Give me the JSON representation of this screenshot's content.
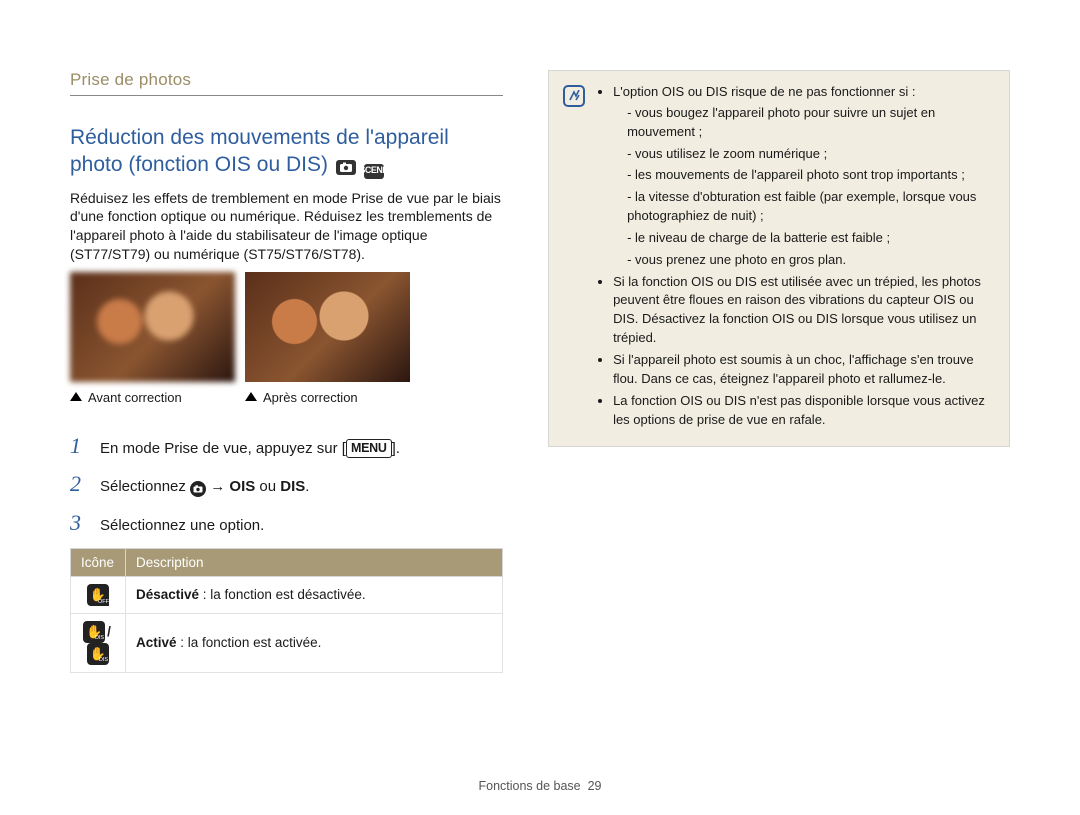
{
  "section_label": "Prise de photos",
  "title": "Réduction des mouvements de l'appareil photo (fonction OIS ou DIS)",
  "title_icon1_name": "camera-mode-icon",
  "title_icon2_name": "scene-mode-icon",
  "title_icon2_label": "SCENE",
  "intro": "Réduisez les effets de tremblement en mode Prise de vue par le biais d'une fonction optique ou numérique. Réduisez les tremblements de l'appareil photo à l'aide du stabilisateur de l'image optique (ST77/ST79) ou numérique (ST75/ST76/ST78).",
  "caption_before": "Avant correction",
  "caption_after": "Après correction",
  "steps": {
    "n1": "1",
    "t1_pre": "En mode Prise de vue, appuyez sur [",
    "t1_menu": "MENU",
    "t1_post": "].",
    "n2": "2",
    "t2_pre": "Sélectionnez ",
    "t2_arrow": " → ",
    "t2_ois": "OIS",
    "t2_ou": " ou ",
    "t2_dis": "DIS",
    "t2_end": ".",
    "n3": "3",
    "t3": "Sélectionnez une option."
  },
  "table": {
    "h_icon": "Icône",
    "h_desc": "Description",
    "row1_label": "Désactivé",
    "row1_text": " : la fonction est désactivée.",
    "row2_label": "Activé",
    "row2_text": " : la fonction est activée."
  },
  "note": {
    "intro": "L'option OIS ou DIS risque de ne pas fonctionner si :",
    "sub1": "vous bougez l'appareil photo pour suivre un sujet en mouvement ;",
    "sub2": "vous utilisez le zoom numérique ;",
    "sub3": "les mouvements de l'appareil photo sont trop importants ;",
    "sub4": "la vitesse d'obturation est faible (par exemple, lorsque vous photographiez de nuit) ;",
    "sub5": "le niveau de charge de la batterie est faible ;",
    "sub6": "vous prenez une photo en gros plan.",
    "b2": "Si la fonction OIS ou DIS est utilisée avec un trépied, les photos peuvent être floues en raison des vibrations du capteur OIS ou DIS. Désactivez la fonction OIS ou DIS lorsque vous utilisez un trépied.",
    "b3": "Si l'appareil photo est soumis à un choc, l'affichage s'en trouve flou. Dans ce cas, éteignez l'appareil photo et rallumez-le.",
    "b4": "La fonction OIS ou DIS n'est pas disponible lorsque vous activez les options de prise de vue en rafale."
  },
  "footer_label": "Fonctions de base",
  "footer_page": "29"
}
